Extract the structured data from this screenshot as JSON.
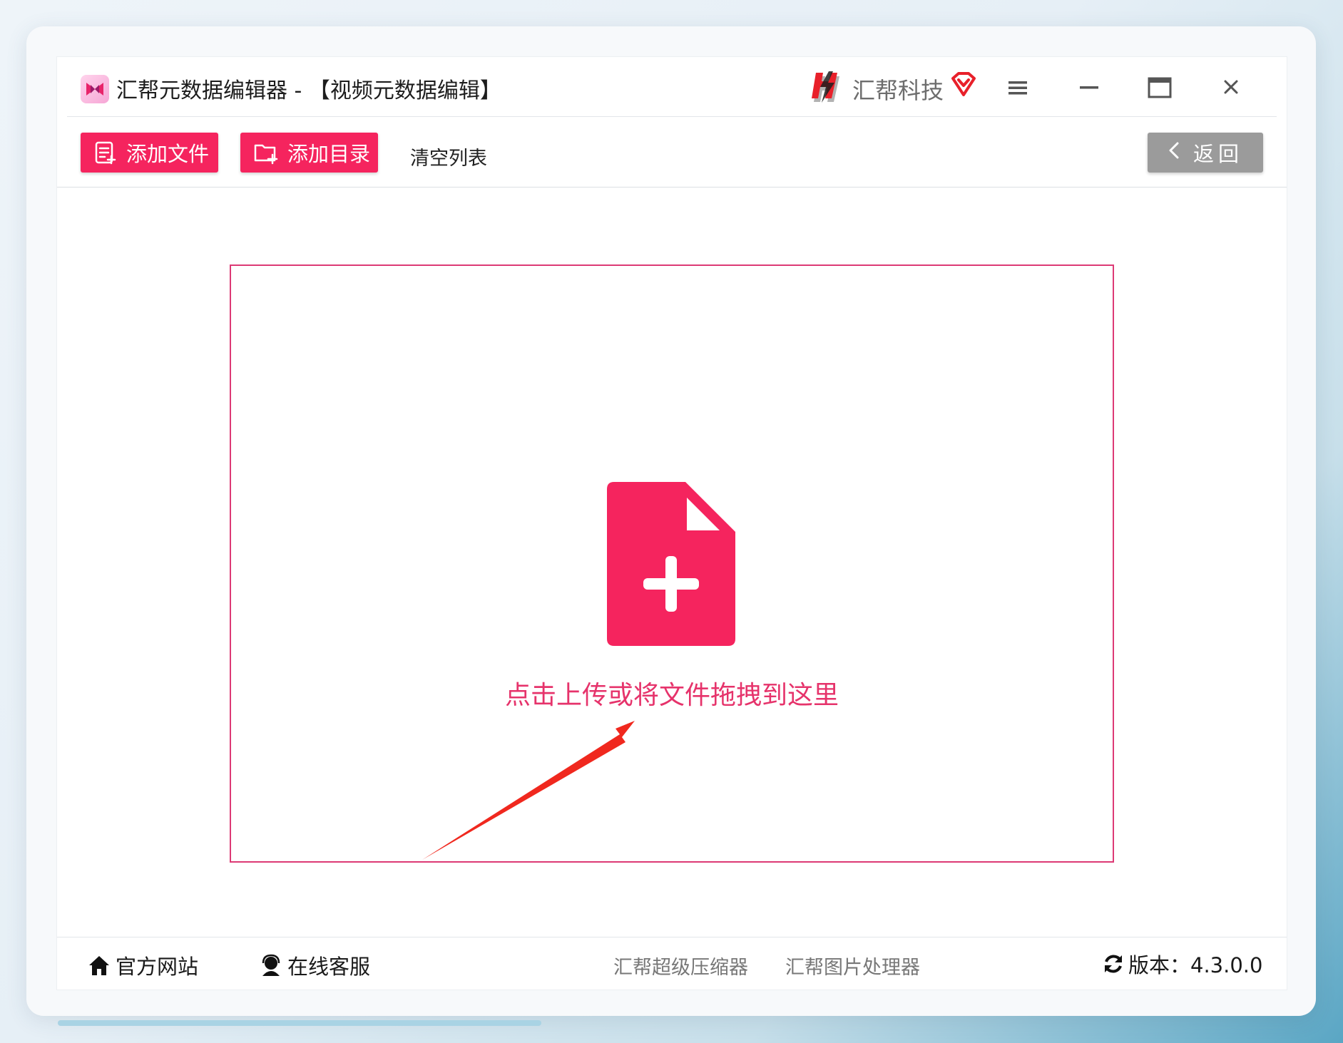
{
  "window": {
    "app_title": "汇帮元数据编辑器 - 【视频元数据编辑】",
    "brand_name": "汇帮科技",
    "app_icon": "bowtie-app-icon",
    "brand_logo": "h-lightning-logo-icon",
    "controls": [
      "menu-icon",
      "minimize-icon",
      "maximize-icon",
      "close-icon"
    ]
  },
  "toolbar": {
    "add_file_label": "添加文件",
    "add_dir_label": "添加目录",
    "clear_label": "清空列表",
    "back_label": "返回"
  },
  "dropzone": {
    "hint": "点击上传或将文件拖拽到这里",
    "icon": "file-plus-icon"
  },
  "footer": {
    "official_site": "官方网站",
    "support": "在线客服",
    "products": [
      "汇帮超级压缩器",
      "汇帮图片处理器"
    ],
    "version_label": "版本：4.3.0.0"
  },
  "colors": {
    "accent": "#f5245e",
    "dropzone_border": "#dd3a75",
    "back_button": "#9b9b9b",
    "annotation_arrow": "#f0281e"
  }
}
